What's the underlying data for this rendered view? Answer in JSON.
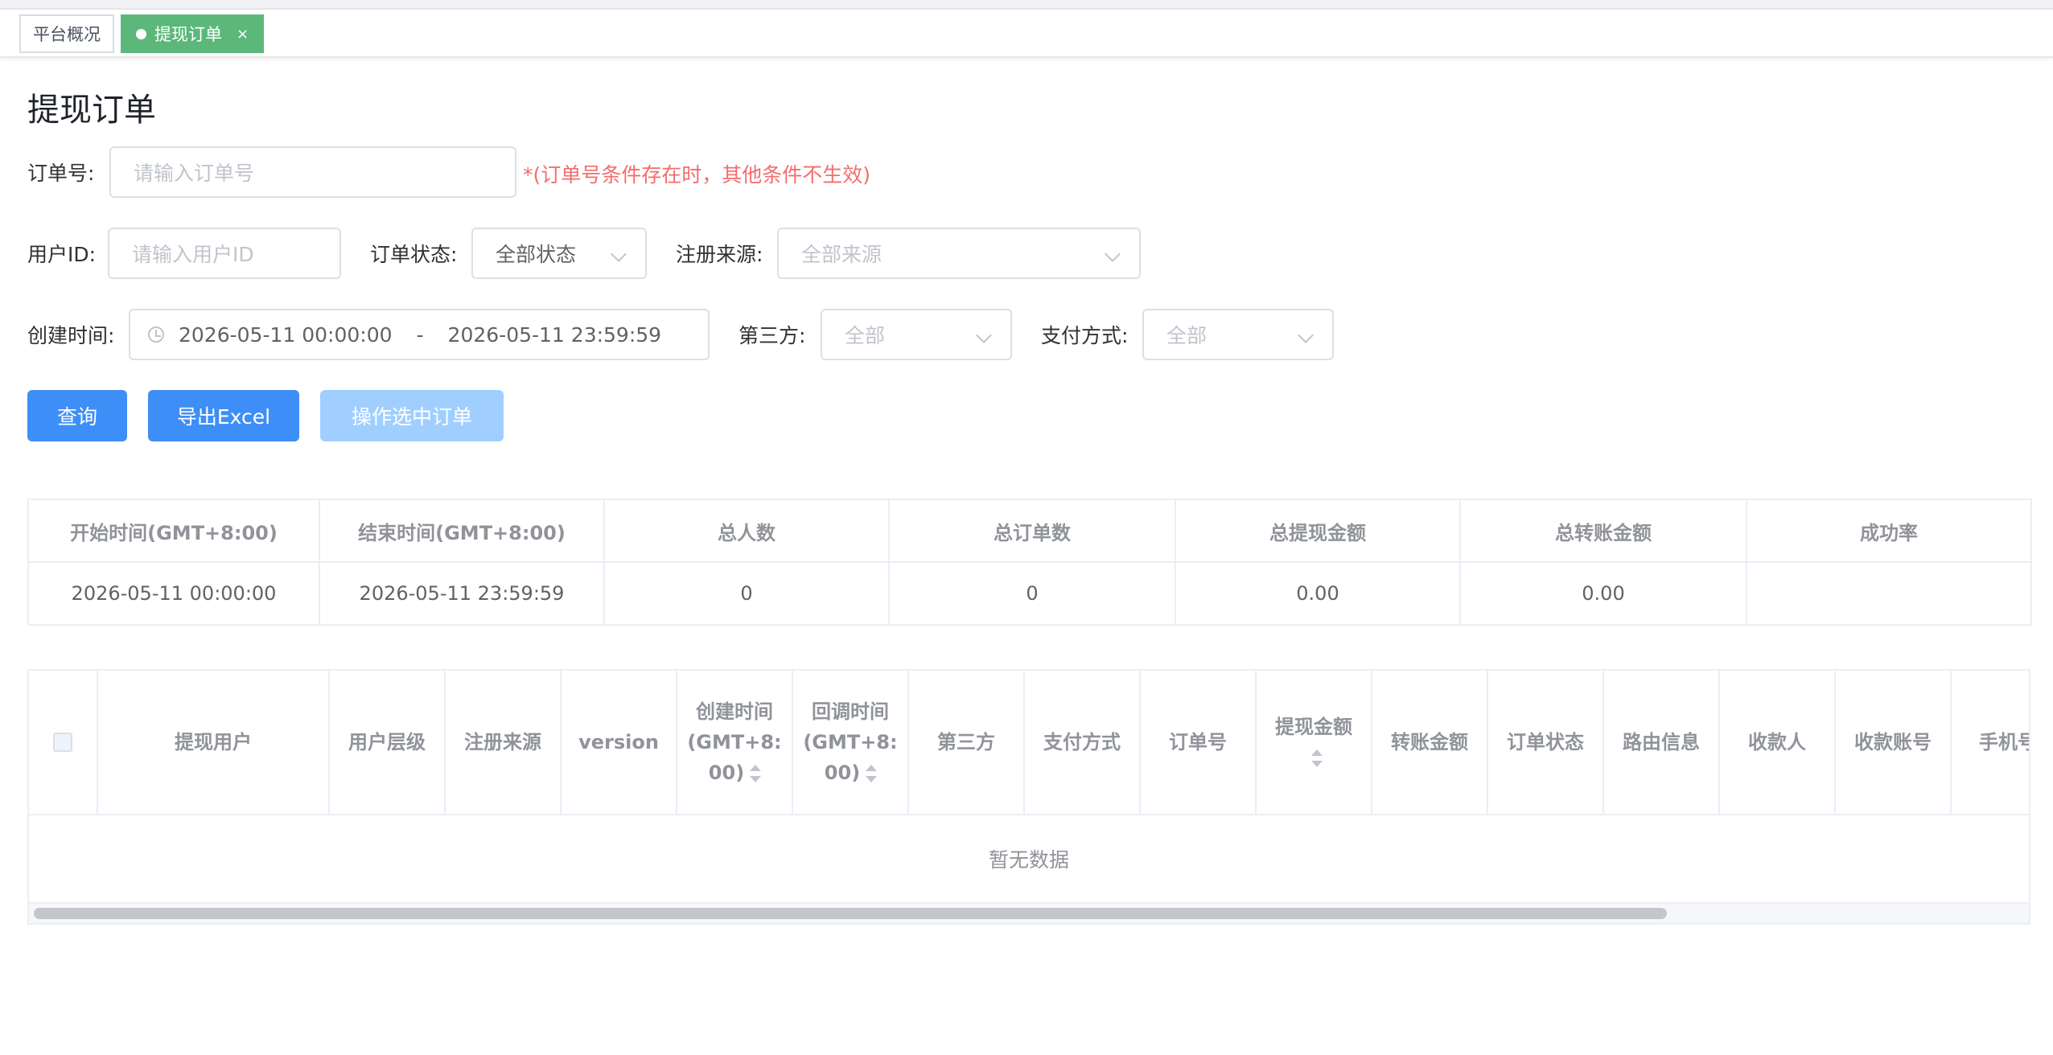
{
  "tabs": [
    {
      "label": "平台概况",
      "active": false
    },
    {
      "label": "提现订单",
      "active": true,
      "close": "×"
    }
  ],
  "page_title": "提现订单",
  "filters": {
    "order_no": {
      "label": "订单号:",
      "placeholder": "请输入订单号",
      "hint": "*(订单号条件存在时，其他条件不生效)"
    },
    "user_id": {
      "label": "用户ID:",
      "placeholder": "请输入用户ID"
    },
    "order_status": {
      "label": "订单状态:",
      "value": "全部状态"
    },
    "reg_source": {
      "label": "注册来源:",
      "placeholder": "全部来源"
    },
    "created_time": {
      "label": "创建时间:",
      "start": "2026-05-11 00:00:00",
      "separator": "-",
      "end": "2026-05-11 23:59:59"
    },
    "third_party": {
      "label": "第三方:",
      "placeholder": "全部"
    },
    "pay_method": {
      "label": "支付方式:",
      "placeholder": "全部"
    }
  },
  "buttons": {
    "query": "查询",
    "export": "导出Excel",
    "operate": "操作选中订单"
  },
  "summary": {
    "headers": [
      "开始时间(GMT+8:00)",
      "结束时间(GMT+8:00)",
      "总人数",
      "总订单数",
      "总提现金额",
      "总转账金额",
      "成功率"
    ],
    "row": [
      "2026-05-11 00:00:00",
      "2026-05-11 23:59:59",
      "0",
      "0",
      "0.00",
      "0.00",
      ""
    ]
  },
  "orders": {
    "headers": {
      "user": "提现用户",
      "level": "用户层级",
      "source": "注册来源",
      "version": "version",
      "created_1": "创建时间",
      "created_2": "(GMT+8:",
      "created_3": "00)",
      "callback_1": "回调时间",
      "callback_2": "(GMT+8:",
      "callback_3": "00)",
      "third": "第三方",
      "pay": "支付方式",
      "order_no": "订单号",
      "amount": "提现金额",
      "transfer": "转账金额",
      "status": "订单状态",
      "route": "路由信息",
      "payee": "收款人",
      "account": "收款账号",
      "phone": "手机号"
    },
    "empty_text": "暂无数据"
  },
  "colors": {
    "primary": "#3e8ef7",
    "primary_disabled": "#a0cfff",
    "tab_active": "#5cb87a",
    "hint": "#f56c6c"
  }
}
